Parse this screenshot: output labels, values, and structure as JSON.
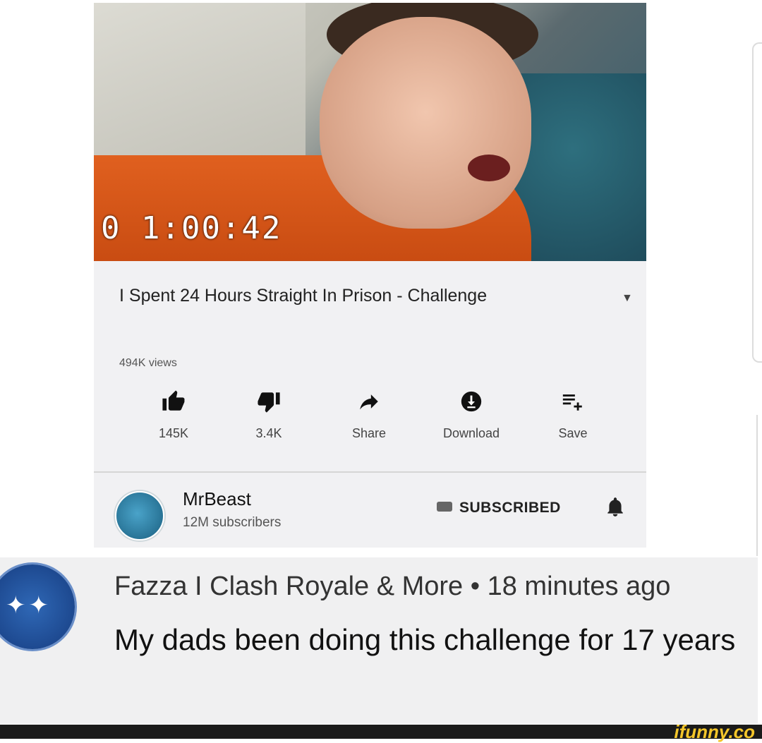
{
  "video": {
    "timer": "0 1:00:42",
    "title": "I Spent 24 Hours Straight In Prison - Challenge",
    "views": "494K views"
  },
  "actions": [
    {
      "icon": "thumbs-up-icon",
      "label": "145K"
    },
    {
      "icon": "thumbs-down-icon",
      "label": "3.4K"
    },
    {
      "icon": "share-icon",
      "label": "Share"
    },
    {
      "icon": "download-icon",
      "label": "Download"
    },
    {
      "icon": "save-playlist-icon",
      "label": "Save"
    }
  ],
  "channel": {
    "name": "MrBeast",
    "subscribers": "12M subscribers",
    "subscribe_label": "SUBSCRIBED"
  },
  "comment": {
    "author": "Fazza I Clash Royale & More • 18 minutes ago",
    "text": "My dads been doing this challenge for 17 years"
  },
  "watermark": "ifunny.co"
}
